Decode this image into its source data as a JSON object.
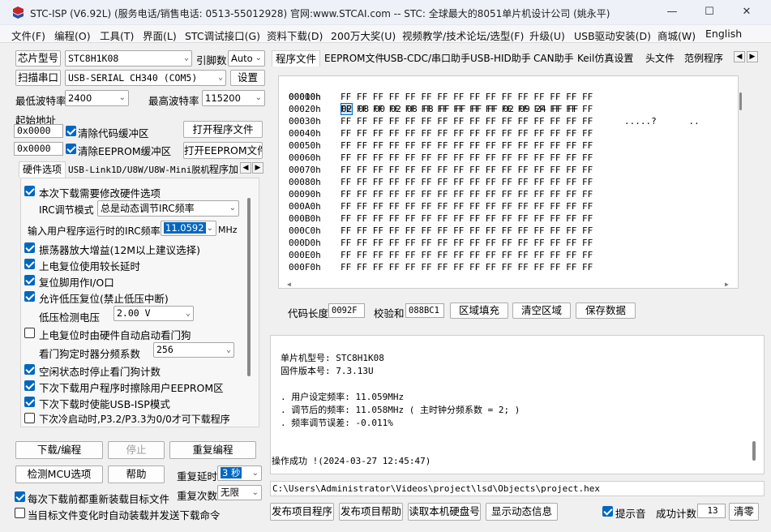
{
  "window": {
    "title": "STC-ISP (V6.92L) (服务电话/销售电话: 0513-55012928) 官网:www.STCAI.com  -- STC: 全球最大的8051单片机设计公司 (姚永平)",
    "minimize": "—",
    "maximize": "☐",
    "close": "✕"
  },
  "menu": [
    "文件(F)",
    "编程(O)",
    "工具(T)",
    "界面(L)",
    "STC调试接口(G)",
    "资料下载(D)",
    "200万大奖(U)",
    "视频教学/技术论坛/选型(F)",
    "升级(U)",
    "USB驱动安装(D)",
    "商城(W)",
    "English"
  ],
  "left": {
    "chip_model_btn": "芯片型号",
    "chip_model_value": "STC8H1K08",
    "pin_count_label": "引脚数",
    "pin_count_value": "Auto",
    "scan_port_btn": "扫描串口",
    "port_value": "USB-SERIAL CH340 (COM5)",
    "settings_btn": "设置",
    "min_baud_label": "最低波特率",
    "min_baud_value": "2400",
    "max_baud_label": "最高波特率",
    "max_baud_value": "115200",
    "start_addr_label": "起始地址",
    "addr1": "0x0000",
    "addr2": "0x0000",
    "clear_code_label": "清除代码缓冲区",
    "clear_eeprom_label": "清除EEPROM缓冲区",
    "open_prog_btn": "打开程序文件",
    "open_eeprom_btn": "打开EEPROM文件",
    "tabs": [
      "硬件选项",
      "USB-Link1D/U8W/U8W-Mini脱机",
      "程序加"
    ],
    "hw_options": {
      "opt_modify_hw": "本次下载需要修改硬件选项",
      "irc_mode_label": "IRC调节模式",
      "irc_mode_value": "总是动态调节IRC频率",
      "irc_freq_label": "输入用户程序运行时的IRC频率",
      "irc_freq_value": "11.0592",
      "irc_freq_unit": "MHz",
      "opt_osc_gain": "振荡器放大增益(12M以上建议选择)",
      "opt_por_delay": "上电复位使用较长延时",
      "opt_reset_io": "复位脚用作I/O口",
      "opt_lvr": "允许低压复位(禁止低压中断)",
      "lvd_label": "低压检测电压",
      "lvd_value": "2.00 V",
      "opt_wdt_auto": "上电复位时由硬件自动启动看门狗",
      "wdt_div_label": "看门狗定时器分频系数",
      "wdt_div_value": "256",
      "opt_wdt_idle": "空闲状态时停止看门狗计数",
      "opt_erase_eeprom": "下次下载用户程序时擦除用户EEPROM区",
      "opt_usb_isp": "下次下载时使能USB-ISP模式",
      "opt_cold_p32": "下次冷启动时,P3.2/P3.3为0/0才可下载程序"
    },
    "download_btn": "下载/编程",
    "stop_btn": "停止",
    "reprogram_btn": "重复编程",
    "detect_btn": "检测MCU选项",
    "help_btn": "帮助",
    "repeat_delay_label": "重复延时",
    "repeat_delay_value": "3 秒",
    "repeat_count_label": "重复次数",
    "repeat_count_value": "无限",
    "reload_each_label": "每次下载前都重新装载目标文件",
    "auto_reload_label": "当目标文件变化时自动装载并发送下载命令"
  },
  "right": {
    "tabs": [
      "程序文件",
      "EEPROM文件",
      "USB-CDC/串口助手",
      "USB-HID助手",
      "CAN助手",
      "Keil仿真设置",
      "头文件",
      "范例程序"
    ],
    "hex_rows": [
      {
        "addr": "00000h",
        "bytes": "02 08 00 02 08 F8 FF FF FF FF 02 09 24 FF FF",
        "ascii": ".....?      .."
      },
      {
        "addr": "00010h",
        "bytes": "FF FF FF FF FF FF FF FF FF FF FF FF FF FF FF FF",
        "ascii": ""
      },
      {
        "addr": "00020h",
        "bytes": "FF FF FF FF FF FF FF FF FF FF FF FF FF FF FF FF",
        "ascii": ""
      },
      {
        "addr": "00030h",
        "bytes": "FF FF FF FF FF FF FF FF FF FF FF FF FF FF FF FF",
        "ascii": ""
      },
      {
        "addr": "00040h",
        "bytes": "FF FF FF FF FF FF FF FF FF FF FF FF FF FF FF FF",
        "ascii": ""
      },
      {
        "addr": "00050h",
        "bytes": "FF FF FF FF FF FF FF FF FF FF FF FF FF FF FF FF",
        "ascii": ""
      },
      {
        "addr": "00060h",
        "bytes": "FF FF FF FF FF FF FF FF FF FF FF FF FF FF FF FF",
        "ascii": ""
      },
      {
        "addr": "00070h",
        "bytes": "FF FF FF FF FF FF FF FF FF FF FF FF FF FF FF FF",
        "ascii": ""
      },
      {
        "addr": "00080h",
        "bytes": "FF FF FF FF FF FF FF FF FF FF FF FF FF FF FF FF",
        "ascii": ""
      },
      {
        "addr": "00090h",
        "bytes": "FF FF FF FF FF FF FF FF FF FF FF FF FF FF FF FF",
        "ascii": ""
      },
      {
        "addr": "000A0h",
        "bytes": "FF FF FF FF FF FF FF FF FF FF FF FF FF FF FF FF",
        "ascii": ""
      },
      {
        "addr": "000B0h",
        "bytes": "FF FF FF FF FF FF FF FF FF FF FF FF FF FF FF FF",
        "ascii": ""
      },
      {
        "addr": "000C0h",
        "bytes": "FF FF FF FF FF FF FF FF FF FF FF FF FF FF FF FF",
        "ascii": ""
      },
      {
        "addr": "000D0h",
        "bytes": "FF FF FF FF FF FF FF FF FF FF FF FF FF FF FF FF",
        "ascii": ""
      },
      {
        "addr": "000E0h",
        "bytes": "FF FF FF FF FF FF FF FF FF FF FF FF FF FF FF FF",
        "ascii": ""
      },
      {
        "addr": "000F0h",
        "bytes": "FF FF FF FF FF FF FF FF FF FF FF FF FF FF FF FF",
        "ascii": ""
      }
    ],
    "code_len_label": "代码长度",
    "code_len_value": "0092F",
    "checksum_label": "校验和",
    "checksum_value": "088BC1",
    "fill_btn": "区域填充",
    "clear_btn": "清空区域",
    "save_btn": "保存数据",
    "log": {
      "l1": "单片机型号: STC8H1K08",
      "l2": "固件版本号: 7.3.13U",
      "l3": ". 用户设定频率: 11.059MHz",
      "l4": ". 调节后的频率: 11.058MHz ( 主时钟分频系数 = 2; )",
      "l5": ". 频率调节误差: -0.011%",
      "l6": "操作成功 !(2024-03-27 12:45:47)"
    },
    "file_path": "C:\\Users\\Administrator\\Videos\\project\\lsd\\Objects\\project.hex",
    "publish_prog_btn": "发布项目程序",
    "publish_help_btn": "发布项目帮助",
    "read_disk_btn": "读取本机硬盘号",
    "show_dyn_btn": "显示动态信息",
    "beep_label": "提示音",
    "success_count_label": "成功计数",
    "success_count_value": "13",
    "clear_count_btn": "清零"
  }
}
